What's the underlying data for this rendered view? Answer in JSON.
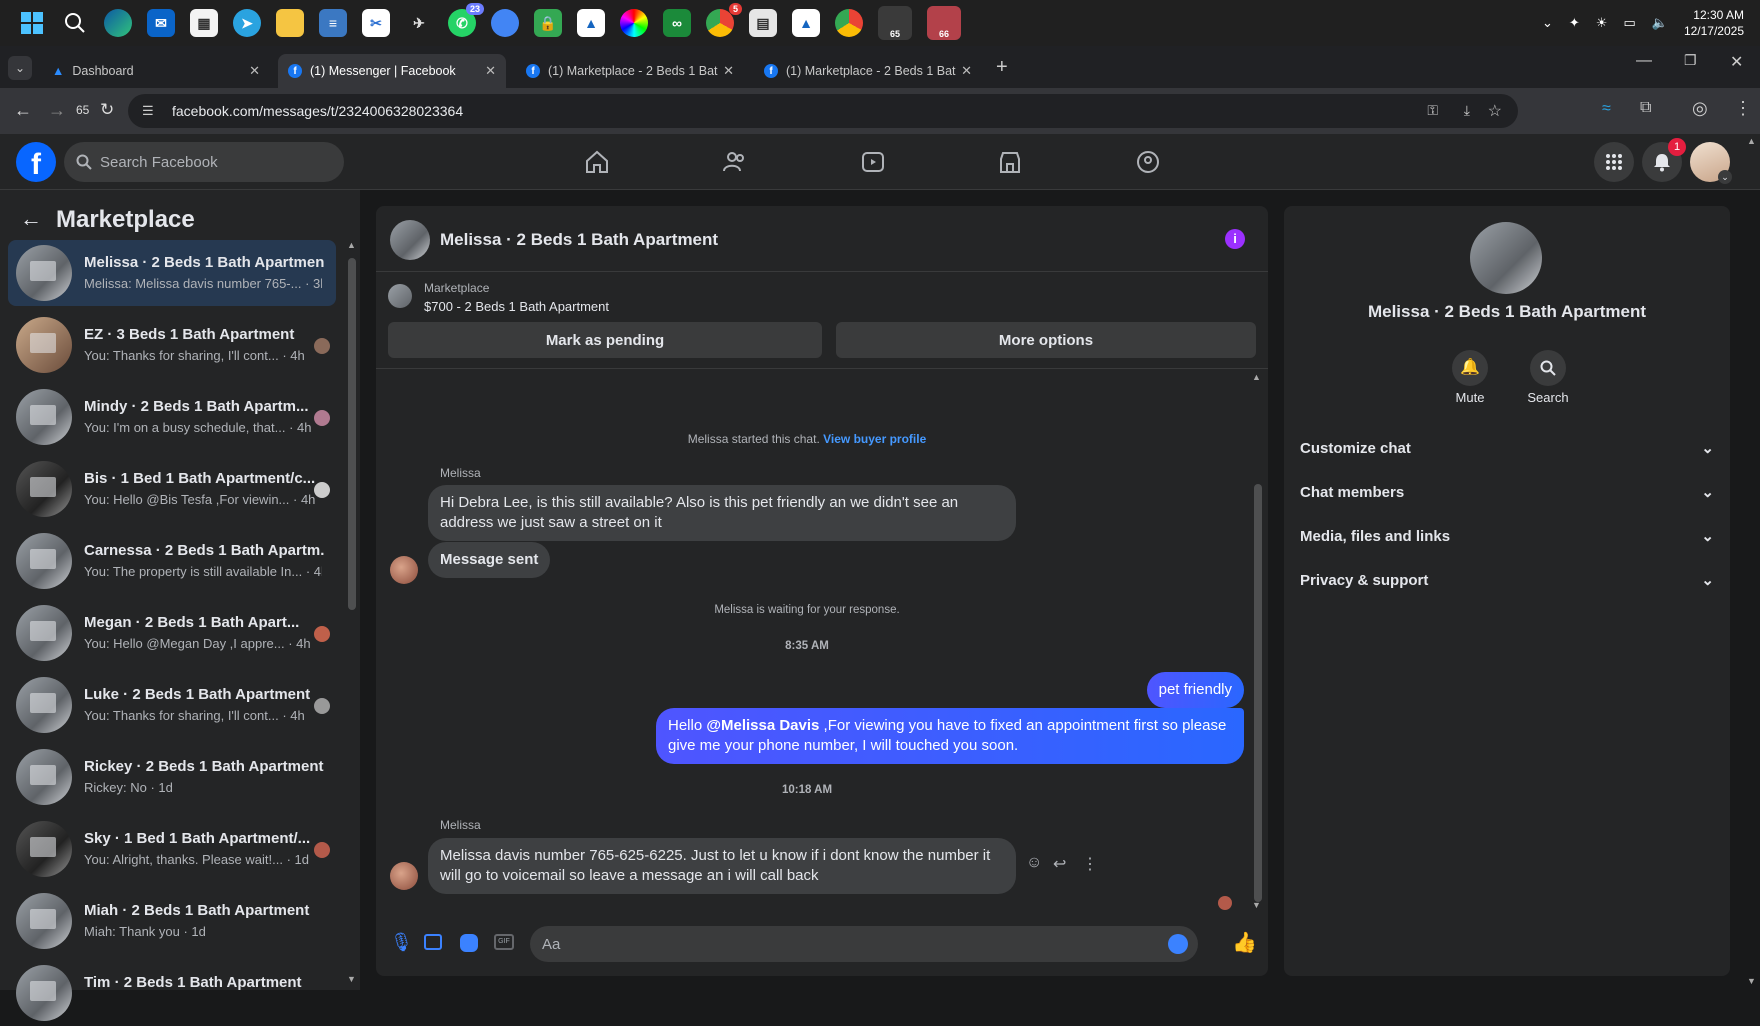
{
  "taskbar": {
    "whatsapp_badge": "23",
    "chrome_badge": "5",
    "app_badge_1": "65",
    "app_badge_2": "66",
    "time": "12:30 AM",
    "date": "12/17/2025"
  },
  "browser": {
    "tabs": [
      {
        "label": "Dashboard"
      },
      {
        "label": "(1) Messenger | Facebook"
      },
      {
        "label": "(1) Marketplace - 2 Beds 1 Bath"
      },
      {
        "label": "(1) Marketplace - 2 Beds 1 Bath"
      }
    ],
    "back_count": "65",
    "url": "facebook.com/messages/t/2324006328023364"
  },
  "fb": {
    "search_placeholder": "Search Facebook",
    "notification_count": "1"
  },
  "left": {
    "title": "Marketplace",
    "conversations": [
      {
        "name": "Melissa · 2 Beds 1 Bath Apartment",
        "preview": "Melissa: Melissa davis number 765-... · 3h"
      },
      {
        "name": "EZ · 3 Beds 1 Bath Apartment",
        "preview": "You: Thanks for sharing, I'll cont... · 4h"
      },
      {
        "name": "Mindy · 2 Beds 1 Bath Apartm...",
        "preview": "You: I'm on a busy schedule, that... · 4h"
      },
      {
        "name": "Bis · 1 Bed 1 Bath Apartment/c...",
        "preview": "You: Hello @Bis Tesfa ,For viewin... · 4h"
      },
      {
        "name": "Carnessa · 2 Beds 1 Bath Apartm...",
        "preview": "You: The property is still available In... · 4h"
      },
      {
        "name": "Megan · 2 Beds 1 Bath Apart...",
        "preview": "You: Hello @Megan Day ,I appre... · 4h"
      },
      {
        "name": "Luke · 2 Beds 1 Bath Apartment",
        "preview": "You: Thanks for sharing, I'll cont... · 4h"
      },
      {
        "name": "Rickey · 2 Beds 1 Bath Apartment",
        "preview": "Rickey: No · 1d"
      },
      {
        "name": "Sky · 1 Bed 1 Bath Apartment/...",
        "preview": "You: Alright, thanks. Please wait!... · 1d"
      },
      {
        "name": "Miah · 2 Beds 1 Bath Apartment",
        "preview": "Miah: Thank you · 1d"
      },
      {
        "name": "Tim · 2 Beds 1 Bath Apartment",
        "preview": ""
      }
    ]
  },
  "chat": {
    "title": "Melissa · 2 Beds 1 Bath Apartment",
    "listing_label": "Marketplace",
    "listing_price": "$700 - 2 Beds 1 Bath Apartment",
    "mark_pending": "Mark as pending",
    "more_options": "More options",
    "started": "Melissa started this chat.",
    "view_buyer": "View buyer profile",
    "sender1": "Melissa",
    "msg1": "Hi Debra Lee, is this still available? Also is this pet friendly an we didn't see an address we just saw a street on it",
    "msg2": "Message sent",
    "waiting": "Melissa is waiting for your response.",
    "time1": "8:35 AM",
    "reply1": "pet friendly",
    "reply2_mention": "@Melissa Davis",
    "reply2_prefix": "Hello ",
    "reply2_rest": " ,For viewing you have to fixed an appointment first so please give me your phone number, I will touched you soon.",
    "time2": "10:18 AM",
    "sender2": "Melissa",
    "msg3": "Melissa davis number 765-625-6225.  Just to let u know if i dont know the number it will go to voicemail so leave a message an i will call back",
    "composer_placeholder": "Aa"
  },
  "right": {
    "name": "Melissa · 2 Beds 1 Bath Apartment",
    "mute": "Mute",
    "search": "Search",
    "sections": [
      "Customize chat",
      "Chat members",
      "Media, files and links",
      "Privacy & support"
    ]
  },
  "colors": {
    "accent": "#0866ff",
    "bubble_out": "#3d5afe",
    "bg": "#18191a",
    "panel": "#242526"
  }
}
